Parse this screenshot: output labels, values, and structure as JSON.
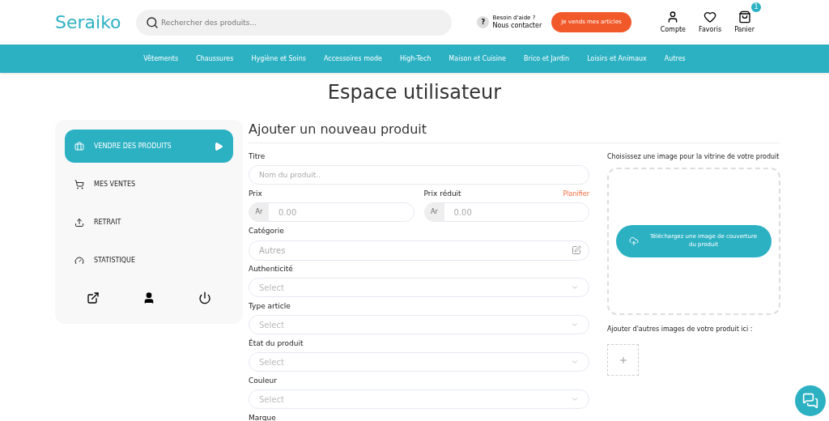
{
  "header": {
    "logo": "Seraiko",
    "search": {
      "placeholder": "Rechercher des produits..."
    },
    "help": {
      "icon": "?",
      "line1": "Besoin d'aide ?",
      "line2": "Nous contacter"
    },
    "sell_button": "Je vends mes articles",
    "actions": [
      {
        "kind": "account",
        "label": "Compte"
      },
      {
        "kind": "favorites",
        "label": "Favoris"
      },
      {
        "kind": "cart",
        "label": "Panier",
        "badge": "1"
      }
    ]
  },
  "nav": [
    "Vêtements",
    "Chaussures",
    "Hygiène et Soins",
    "Accessoires mode",
    "High-Tech",
    "Maison et Cuisine",
    "Brico et Jardin",
    "Loisirs et Animaux",
    "Autres"
  ],
  "page_title": "Espace utilisateur",
  "sidebar": {
    "items": [
      {
        "kind": "sell",
        "label": "VENDRE DES PRODUITS",
        "selected": true
      },
      {
        "kind": "cart",
        "label": "MES VENTES",
        "selected": false
      },
      {
        "kind": "upload",
        "label": "RETRAIT",
        "selected": false
      },
      {
        "kind": "stats",
        "label": "STATISTIQUE",
        "selected": false
      }
    ]
  },
  "form": {
    "title": "Ajouter un nouveau produit",
    "fields": [
      {
        "kind": "text",
        "label": "Titre",
        "placeholder": "Nom du produit.."
      },
      {
        "kind": "prices",
        "items": [
          {
            "label": "Prix",
            "prefix": "Ar",
            "placeholder": "0.00"
          },
          {
            "label": "Prix réduit",
            "prefix": "Ar",
            "placeholder": "0.00",
            "link": "Planifier"
          }
        ]
      },
      {
        "kind": "category",
        "label": "Catégorie",
        "placeholder": "Autres"
      },
      {
        "kind": "select",
        "label": "Authenticité",
        "placeholder": "Select"
      },
      {
        "kind": "select",
        "label": "Type article",
        "placeholder": "Select"
      },
      {
        "kind": "select",
        "label": "État du produit",
        "placeholder": "Select"
      },
      {
        "kind": "select",
        "label": "Couleur",
        "placeholder": "Select"
      },
      {
        "kind": "cut",
        "label": "Marque"
      }
    ]
  },
  "images": {
    "cover_label": "Choisissez une image pour la vitrine de votre produit",
    "upload_button": "Téléchargez une image de couverture du produit",
    "more_label": "Ajouter d'autres images de votre produit ici :"
  }
}
